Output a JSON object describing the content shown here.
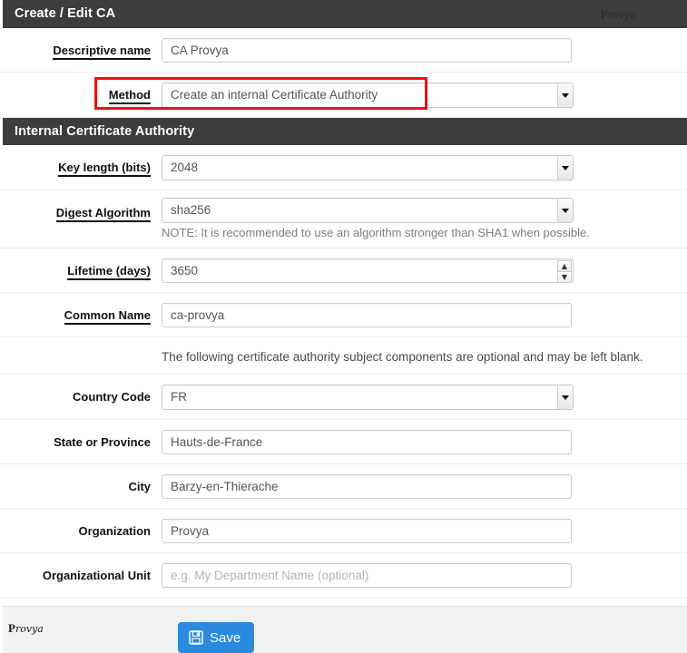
{
  "header": {
    "title": "Create / Edit CA",
    "logo_cap": "P",
    "logo_rest": "rovya"
  },
  "section_header": {
    "title": "Internal Certificate Authority"
  },
  "top_form": {
    "descriptive_name": {
      "label": "Descriptive name",
      "value": "CA Provya"
    },
    "method": {
      "label": "Method",
      "value": "Create an internal Certificate Authority"
    }
  },
  "internal_ca": {
    "key_length": {
      "label": "Key length (bits)",
      "value": "2048"
    },
    "digest_algorithm": {
      "label": "Digest Algorithm",
      "value": "sha256",
      "note": "NOTE: It is recommended to use an algorithm stronger than SHA1 when possible."
    },
    "lifetime": {
      "label": "Lifetime (days)",
      "value": "3650"
    },
    "common_name": {
      "label": "Common Name",
      "value": "ca-provya"
    },
    "optional_note": "The following certificate authority subject components are optional and may be left blank.",
    "country_code": {
      "label": "Country Code",
      "value": "FR"
    },
    "state_or_province": {
      "label": "State or Province",
      "value": "Hauts-de-France"
    },
    "city": {
      "label": "City",
      "value": "Barzy-en-Thierache"
    },
    "organization": {
      "label": "Organization",
      "value": "Provya"
    },
    "organizational_unit": {
      "label": "Organizational Unit",
      "value": "",
      "placeholder": "e.g. My Department Name (optional)"
    }
  },
  "footer": {
    "save_label": "Save",
    "logo_cap": "P",
    "logo_rest": "rovya"
  },
  "annotation": {
    "highlight_color": "#ee1111",
    "target": "method-row"
  },
  "colors": {
    "header_bg": "#3d3d3d",
    "accent_button": "#2b8ae0",
    "highlight": "#ee1111",
    "footer_bg": "#f2f2f2"
  }
}
